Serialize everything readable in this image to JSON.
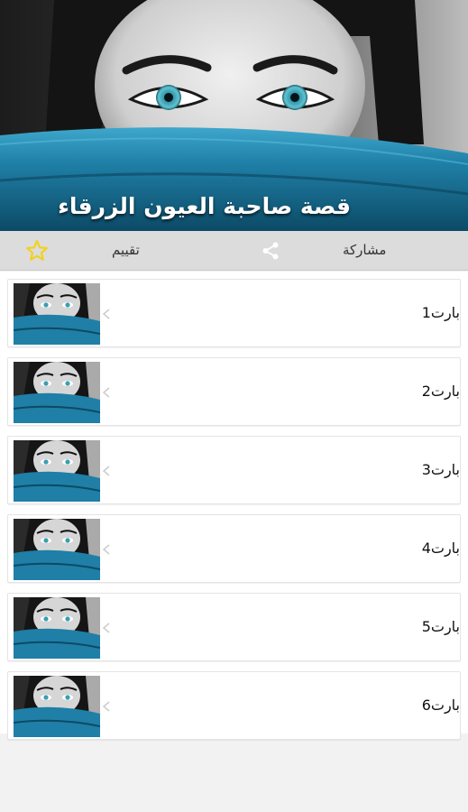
{
  "header": {
    "title": "قصة صاحبة العيون الزرقاء"
  },
  "action_bar": {
    "rate_label": "تقييم",
    "rate_icon": "star-icon",
    "share_label": "مشاركة",
    "share_icon": "share-icon"
  },
  "colors": {
    "accent_star": "#f2d21b",
    "scarf_blue": "#1f7fa6",
    "eye_blue": "#4fb3c4"
  },
  "list": {
    "items": [
      {
        "label": "بارت1",
        "thumbnail": "blue-eyes-thumbnail"
      },
      {
        "label": "بارت2",
        "thumbnail": "blue-eyes-thumbnail"
      },
      {
        "label": "بارت3",
        "thumbnail": "blue-eyes-thumbnail"
      },
      {
        "label": "بارت4",
        "thumbnail": "blue-eyes-thumbnail"
      },
      {
        "label": "بارت5",
        "thumbnail": "blue-eyes-thumbnail"
      },
      {
        "label": "بارت6",
        "thumbnail": "blue-eyes-thumbnail"
      }
    ]
  }
}
